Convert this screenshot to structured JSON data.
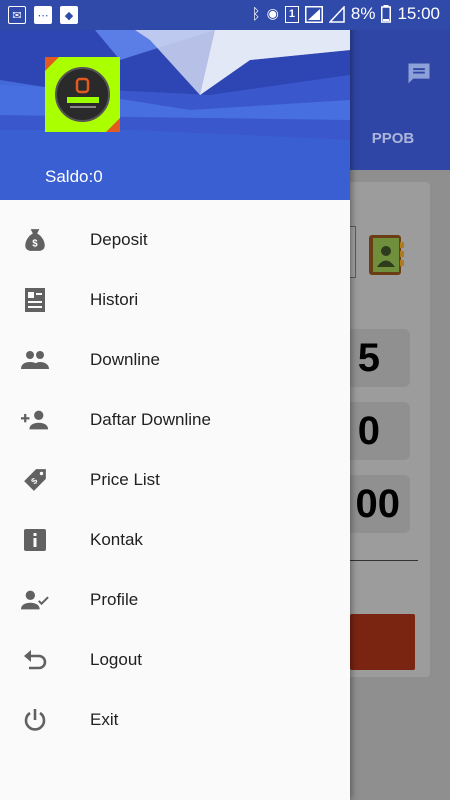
{
  "status_bar": {
    "battery": "8%",
    "time": "15:00",
    "sim": "1",
    "left_icons": [
      "notification-icon",
      "chat-bubble-icon",
      "image-icon"
    ]
  },
  "background_app": {
    "tab_label": "PPOB",
    "amount_digits": [
      "5",
      "0",
      "00"
    ]
  },
  "drawer": {
    "saldo": "Saldo:0",
    "menu": [
      {
        "label": "Deposit",
        "icon": "money-bag-icon"
      },
      {
        "label": "Histori",
        "icon": "document-icon"
      },
      {
        "label": "Downline",
        "icon": "people-icon"
      },
      {
        "label": "Daftar Downline",
        "icon": "person-add-icon"
      },
      {
        "label": "Price List",
        "icon": "price-tag-icon"
      },
      {
        "label": "Kontak",
        "icon": "info-icon"
      },
      {
        "label": "Profile",
        "icon": "person-check-icon"
      },
      {
        "label": "Logout",
        "icon": "undo-icon"
      },
      {
        "label": "Exit",
        "icon": "power-icon"
      }
    ]
  },
  "colors": {
    "header_blue": "#3b5fd1",
    "app_bar": "#2f46a6",
    "icon_grey": "#616161",
    "logo_green": "#aaff00"
  }
}
